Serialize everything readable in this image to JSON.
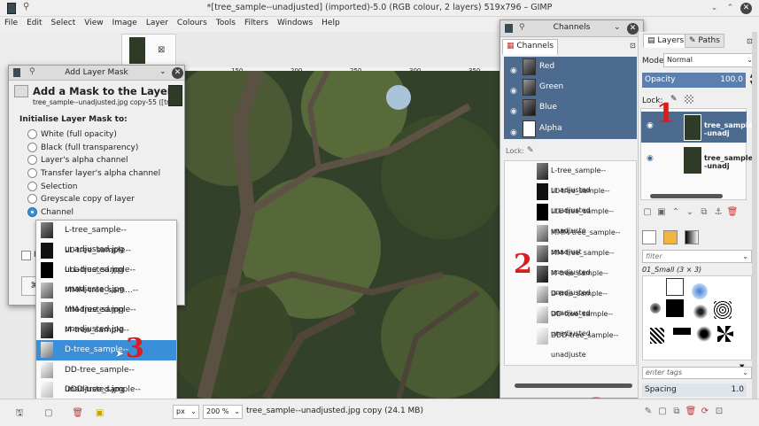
{
  "window": {
    "title": "*[tree_sample--unadjusted] (imported)-5.0 (RGB colour, 2 layers) 519x796 – GIMP"
  },
  "menu": [
    "File",
    "Edit",
    "Select",
    "View",
    "Image",
    "Layer",
    "Colours",
    "Tools",
    "Filters",
    "Windows",
    "Help"
  ],
  "ruler": {
    "ticks": [
      "150",
      "200",
      "250",
      "300",
      "350"
    ]
  },
  "add_mask": {
    "dialog_title": "Add Layer Mask",
    "heading": "Add a Mask to the Layer",
    "subtitle": "tree_sample--unadjusted.jpg copy-55 ([tr...",
    "section": "Initialise Layer Mask to:",
    "options": [
      "White (full opacity)",
      "Black (full transparency)",
      "Layer's alpha channel",
      "Transfer layer's alpha channel",
      "Selection",
      "Greyscale copy of layer",
      "Channel"
    ],
    "selected_index": 6,
    "invert_label": "In",
    "channel_list": [
      "L-tree_sample--unadjusted.jpg",
      "LL-tree_sample--unadjusted.jpg",
      "LLL-tree_sample--unadjusted.jpg",
      "MMM-tree_sam...--unadjusted.jpg",
      "MM-tree_sample--unadjusted.jpg",
      "M-tree_sample--unadjusted.jpg",
      "D-tree_sample--unadjusted.jpg",
      "DD-tree_sample--unadjusted.jpg",
      "DDD-tree_sample--unadjusted.jpg"
    ],
    "highlighted_index": 6
  },
  "channels": {
    "dialog_title": "Channels",
    "tab_label": "Channels",
    "color_channels": [
      "Red",
      "Green",
      "Blue",
      "Alpha"
    ],
    "lock_label": "Lock:",
    "custom_channels": [
      "L-tree_sample--unadjusted",
      "LL-tree_sample--unadjusted",
      "LLL-tree_sample--unadjuste",
      "MMM-tree_sample--unadjust",
      "MM-tree_sample--unadjusted",
      "M-tree_sample--unadjusted",
      "D-tree_sample--unadjusted",
      "DD-tree_sample--unadjusted",
      "DDD-tree_sample--unadjuste"
    ]
  },
  "layers": {
    "tab_layers": "Layers",
    "tab_paths": "Paths",
    "mode_label": "Mode",
    "mode_value": "Normal",
    "opacity_label": "Opacity",
    "opacity_value": "100.0",
    "lock_label": "Lock:",
    "items": [
      "tree_sample--unadj",
      "tree_sample--unadj"
    ]
  },
  "brushes": {
    "filter_placeholder": "filter",
    "brush_name": "01_Small (3 × 3)",
    "tags_placeholder": "enter tags",
    "spacing_label": "Spacing",
    "spacing_value": "1.0"
  },
  "status": {
    "unit": "px",
    "zoom": "200 %",
    "message": "tree_sample--unadjusted.jpg copy (24.1 MB)"
  },
  "annotations": [
    "1",
    "2",
    "3"
  ],
  "colors": {
    "selection": "#3b8fd9",
    "channel_bg": "#4d6b8e",
    "annotation": "#d81e1e"
  }
}
